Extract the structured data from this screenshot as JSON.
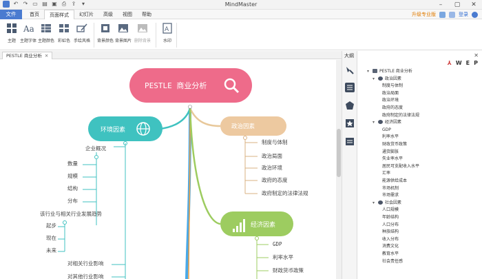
{
  "app": {
    "title": "MindMaster"
  },
  "menu": {
    "file": "文件",
    "tabs": [
      "首页",
      "页面样式",
      "幻灯片",
      "高级",
      "视图",
      "帮助"
    ],
    "active_index": 1,
    "upgrade": "升级专业版",
    "login": "登录"
  },
  "ribbon": {
    "buttons": [
      {
        "label": "主题",
        "icon": "theme-icon"
      },
      {
        "label": "主题字体",
        "icon": "font-icon"
      },
      {
        "label": "主题颜色",
        "icon": "theme-color-icon"
      },
      {
        "label": "彩虹色",
        "icon": "rainbow-icon"
      },
      {
        "label": "手绘风格",
        "icon": "hand-draw-icon"
      },
      {
        "label": "背景颜色",
        "icon": "bg-color-icon"
      },
      {
        "label": "背景图片",
        "icon": "bg-image-icon"
      },
      {
        "label": "删除背景",
        "icon": "remove-bg-icon"
      },
      {
        "label": "水印",
        "icon": "watermark-icon"
      }
    ]
  },
  "document": {
    "tab_title": "PESTLE 商业分析"
  },
  "panel": {
    "title": "大纲",
    "tools": [
      "W",
      "E",
      "P"
    ]
  },
  "mindmap": {
    "root": "PESTLE 商业分析",
    "env": {
      "title": "环境因素",
      "items": [
        "企业概况",
        "数量",
        "规模",
        "结构",
        "分布",
        "该行业与相关行业发展趋势",
        "起步",
        "现在",
        "未来",
        "对相关行业影响",
        "对其他行业影响"
      ]
    },
    "politics": {
      "title": "政治因素",
      "items": [
        "制度与体制",
        "政治局面",
        "政治环境",
        "政府的态度",
        "政府制定的法律法规"
      ]
    },
    "economy": {
      "title": "经济因素",
      "items": [
        "GDP",
        "利率水平",
        "财政货币政策"
      ]
    }
  },
  "outline": [
    {
      "text": "PESTLE 商业分析",
      "level": 0,
      "caret": "▾",
      "icon": "folder"
    },
    {
      "text": "政治因素",
      "level": 1,
      "caret": "▾",
      "icon": "node"
    },
    {
      "text": "制度与体制",
      "level": 2
    },
    {
      "text": "政治局面",
      "level": 2
    },
    {
      "text": "政治环境",
      "level": 2
    },
    {
      "text": "政府的态度",
      "level": 2
    },
    {
      "text": "政府制定的法律法规",
      "level": 2
    },
    {
      "text": "经济因素",
      "level": 1,
      "caret": "▾",
      "icon": "node"
    },
    {
      "text": "GDP",
      "level": 2
    },
    {
      "text": "利率水平",
      "level": 2
    },
    {
      "text": "财政货币政策",
      "level": 2
    },
    {
      "text": "通货膨胀",
      "level": 2
    },
    {
      "text": "失业率水平",
      "level": 2
    },
    {
      "text": "居民可支配收入水平",
      "level": 2
    },
    {
      "text": "汇率",
      "level": 2
    },
    {
      "text": "能源供给成本",
      "level": 2
    },
    {
      "text": "市场机制",
      "level": 2
    },
    {
      "text": "市场需求",
      "level": 2
    },
    {
      "text": "社会因素",
      "level": 1,
      "caret": "▾",
      "icon": "node"
    },
    {
      "text": "人口规模",
      "level": 2
    },
    {
      "text": "年龄结构",
      "level": 2
    },
    {
      "text": "人口分布",
      "level": 2
    },
    {
      "text": "种族结构",
      "level": 2
    },
    {
      "text": "收入分布",
      "level": 2
    },
    {
      "text": "消费文化",
      "level": 2
    },
    {
      "text": "教育水平",
      "level": 2
    },
    {
      "text": "社会责任感",
      "level": 2
    }
  ]
}
